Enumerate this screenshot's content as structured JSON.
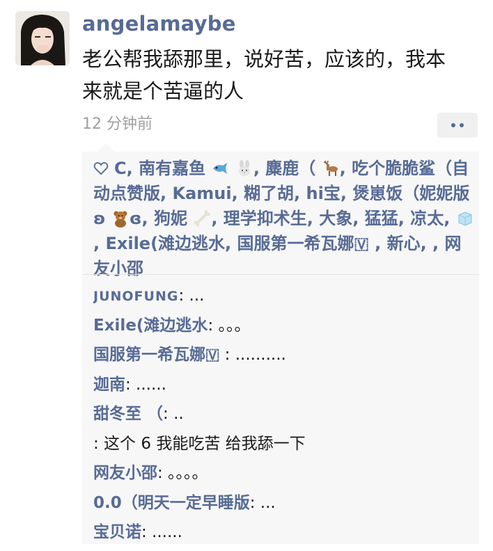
{
  "post": {
    "username": "angelamaybe",
    "text": "老公帮我舔那里，说好苦，应该的，我本\n来就是个苦逼的人",
    "time": "12 分钟前"
  },
  "likes": {
    "p1": "C, 南有嘉鱼",
    "p2": ", 麋鹿（",
    "p3": ", 吃个脆脆鲨（自动点赞版, Kamui, 糊了胡, hi宝, 煲崽饭（妮妮版ʚ",
    "p4": "ɞ, 狗妮",
    "p5": ", 理学抑术生, 大象, 猛猛, 凉太, ",
    "p6": ", Exile(滩边逃水, 国服第一希瓦娜🇻 , 新心, , 网友小邵"
  },
  "comments": [
    {
      "name": "JUNOFUNG",
      "text": ": ...",
      "small": true
    },
    {
      "name": "Exile(滩边逃水",
      "text": ": 。。。"
    },
    {
      "name": "国服第一希瓦娜🇻",
      "text": " : .........."
    },
    {
      "name": "迦南",
      "text": ": ......"
    },
    {
      "name": "甜冬至 （",
      "text": ": .."
    },
    {
      "name": "",
      "text": ": 这个 6 我能吃苦 给我舔一下"
    },
    {
      "name": "网友小邵",
      "text": ": 。。。。"
    },
    {
      "name": "0.0（明天一定早睡版",
      "text": ": ..."
    },
    {
      "name": "宝贝诺",
      "text": ": ......"
    }
  ],
  "icons": {
    "heart": "heart-icon",
    "fish": "fish-emoji-icon",
    "rabbit": "rabbit-emoji-icon",
    "deer": "deer-emoji-icon",
    "bear": "teddy-bear-emoji-icon",
    "bone": "bone-emoji-icon",
    "ice": "ice-cube-emoji-icon",
    "more": "more-dots-icon"
  },
  "colors": {
    "link": "#576b95",
    "text": "#1a1a1a",
    "muted": "#a0a0a0",
    "panel": "#f7f7f7"
  }
}
